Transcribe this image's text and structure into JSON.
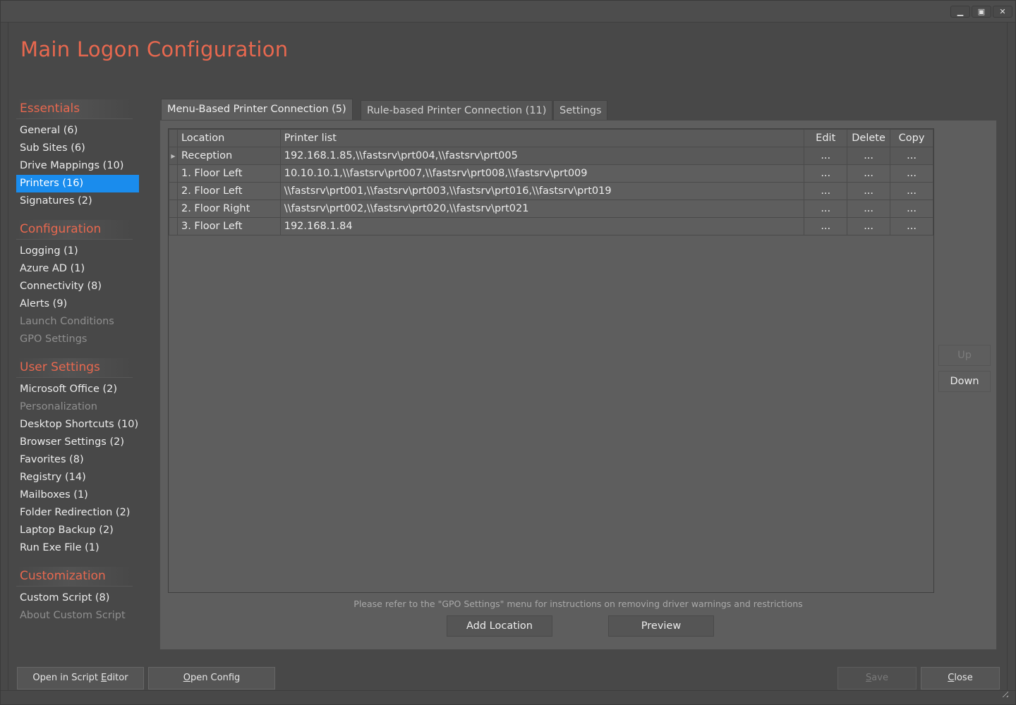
{
  "window": {
    "controls": {
      "minimize": "▁",
      "maximize": "▣",
      "close": "✕"
    }
  },
  "header": {
    "title": "Main Logon Configuration"
  },
  "sidebar": {
    "sections": [
      {
        "title": "Essentials",
        "items": [
          {
            "label": "General (6)",
            "state": "normal"
          },
          {
            "label": "Sub Sites (6)",
            "state": "normal"
          },
          {
            "label": "Drive Mappings (10)",
            "state": "normal"
          },
          {
            "label": "Printers (16)",
            "state": "active"
          },
          {
            "label": "Signatures (2)",
            "state": "normal"
          }
        ]
      },
      {
        "title": "Configuration",
        "items": [
          {
            "label": "Logging (1)",
            "state": "normal"
          },
          {
            "label": "Azure AD (1)",
            "state": "normal"
          },
          {
            "label": "Connectivity (8)",
            "state": "normal"
          },
          {
            "label": "Alerts (9)",
            "state": "normal"
          },
          {
            "label": "Launch Conditions",
            "state": "disabled"
          },
          {
            "label": "GPO Settings",
            "state": "disabled"
          }
        ]
      },
      {
        "title": "User Settings",
        "items": [
          {
            "label": "Microsoft Office (2)",
            "state": "normal"
          },
          {
            "label": "Personalization",
            "state": "disabled"
          },
          {
            "label": "Desktop Shortcuts (10)",
            "state": "normal"
          },
          {
            "label": "Browser Settings (2)",
            "state": "normal"
          },
          {
            "label": "Favorites (8)",
            "state": "normal"
          },
          {
            "label": "Registry (14)",
            "state": "normal"
          },
          {
            "label": "Mailboxes (1)",
            "state": "normal"
          },
          {
            "label": "Folder Redirection (2)",
            "state": "normal"
          },
          {
            "label": "Laptop Backup (2)",
            "state": "normal"
          },
          {
            "label": "Run Exe File (1)",
            "state": "normal"
          }
        ]
      },
      {
        "title": "Customization",
        "items": [
          {
            "label": "Custom Script (8)",
            "state": "normal"
          },
          {
            "label": "About Custom Script",
            "state": "disabled"
          }
        ]
      }
    ]
  },
  "tabs": [
    {
      "label": "Menu-Based Printer Connection (5)",
      "active": true
    },
    {
      "label": "Rule-based Printer Connection (11)",
      "active": false
    },
    {
      "label": "Settings",
      "active": false
    }
  ],
  "grid": {
    "columns": {
      "location": "Location",
      "printer_list": "Printer list",
      "edit": "Edit",
      "delete": "Delete",
      "copy": "Copy"
    },
    "row_marker": "▶",
    "action_label": "...",
    "rows": [
      {
        "location": "Reception",
        "printers": "192.168.1.85,\\\\fastsrv\\prt004,\\\\fastsrv\\prt005",
        "current": true
      },
      {
        "location": "1. Floor Left",
        "printers": "10.10.10.1,\\\\fastsrv\\prt007,\\\\fastsrv\\prt008,\\\\fastsrv\\prt009",
        "current": false
      },
      {
        "location": "2. Floor Left",
        "printers": "\\\\fastsrv\\prt001,\\\\fastsrv\\prt003,\\\\fastsrv\\prt016,\\\\fastsrv\\prt019",
        "current": false
      },
      {
        "location": "2. Floor Right",
        "printers": "\\\\fastsrv\\prt002,\\\\fastsrv\\prt020,\\\\fastsrv\\prt021",
        "current": false
      },
      {
        "location": "3. Floor Left",
        "printers": "192.168.1.84",
        "current": false
      }
    ]
  },
  "order_buttons": {
    "up": "Up",
    "down": "Down"
  },
  "panel": {
    "note": "Please refer to the \"GPO Settings\" menu for instructions on removing driver warnings and restrictions",
    "add_location": "Add Location",
    "preview": "Preview"
  },
  "footer": {
    "open_script_editor": {
      "before": "Open in Script ",
      "mnemonic": "E",
      "after": "ditor"
    },
    "open_config": {
      "before": "",
      "mnemonic": "O",
      "after": "pen Config"
    },
    "save": {
      "before": "",
      "mnemonic": "S",
      "after": "ave"
    },
    "close": {
      "before": "",
      "mnemonic": "C",
      "after": "lose"
    }
  }
}
